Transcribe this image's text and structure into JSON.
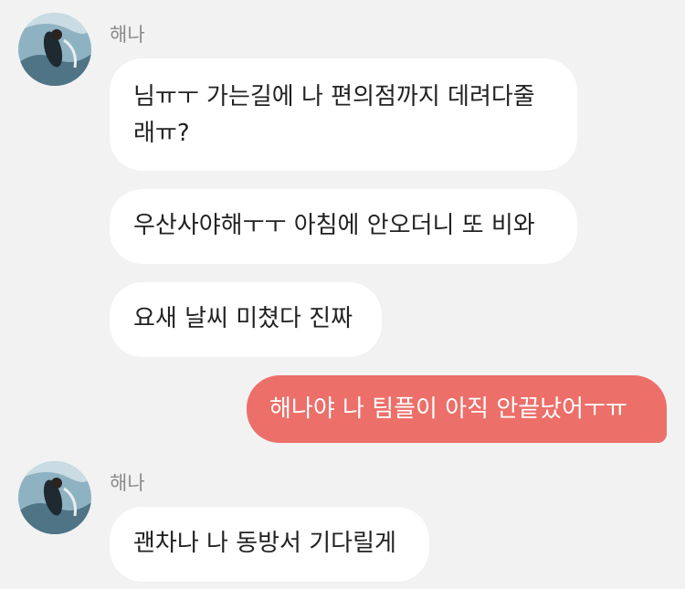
{
  "colors": {
    "background": "#f2f2f2",
    "incoming_bubble": "#ffffff",
    "outgoing_bubble": "#ec6f69",
    "sender_name": "#8a8a8a"
  },
  "groups": [
    {
      "sender": "해나",
      "avatar_icon": "profile-photo-avatar",
      "messages": [
        {
          "direction": "incoming",
          "lines": [
            "님ㅠㅜ 가는길에 나 편의점까지 데려다줄",
            "래ㅠ?"
          ]
        },
        {
          "direction": "incoming",
          "lines": [
            "우산사야해ㅜㅜ 아침에 안오더니 또 비와"
          ]
        },
        {
          "direction": "incoming",
          "lines": [
            "요새 날씨 미쳤다 진짜"
          ]
        }
      ]
    },
    {
      "sender": "me",
      "messages": [
        {
          "direction": "outgoing",
          "lines": [
            "해나야 나 팀플이 아직 안끝났어ㅜㅠ"
          ]
        }
      ]
    },
    {
      "sender": "해나",
      "avatar_icon": "profile-photo-avatar",
      "messages": [
        {
          "direction": "incoming",
          "lines": [
            "괜차나 나 동방서 기다릴게"
          ]
        }
      ]
    }
  ]
}
